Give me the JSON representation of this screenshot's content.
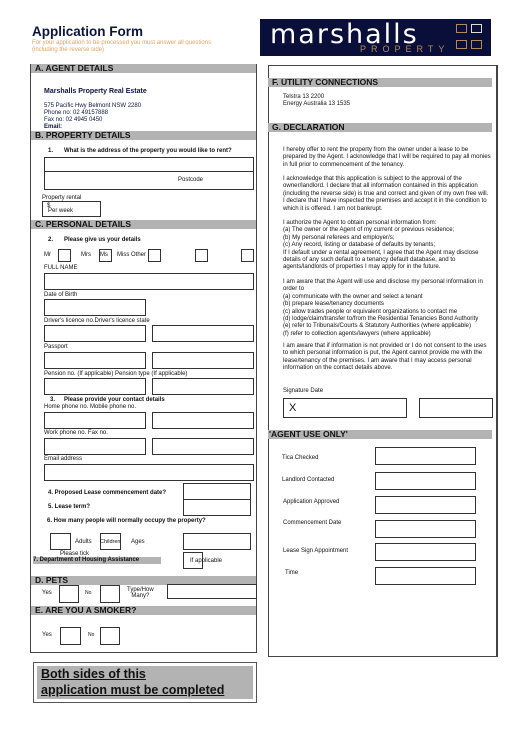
{
  "header": {
    "title": "Application Form",
    "subtitle": "For your application to be processed you must answer all questions (including the reverse side)",
    "logo_text": "marshalls",
    "logo_sub": "PROPERTY",
    "brand_color": "#0a0f3a",
    "accent_color": "#e3a360"
  },
  "agent": {
    "heading": "A. AGENT DETAILS",
    "name": "Marshalls Property Real Estate",
    "address": "575 Pacific Hwy Belmont NSW 2280",
    "phone": "Phone no: 02 49157888",
    "fax": "Fax no: 02 4945 0450",
    "email": "Email:"
  },
  "property": {
    "heading": "B. PROPERTY DETAILS",
    "q1_num": "1.",
    "q1": "What is the address of the property you would like to rent?",
    "postcode": "Postcode",
    "rental_label": "Property rental",
    "dollar": "$",
    "per_week": "Per week"
  },
  "personal": {
    "heading": "C. PERSONAL DETAILS",
    "q2_num": "2.",
    "q2": "Please give us your details",
    "mr": "Mr",
    "mrs": "Mrs",
    "ms": "Ms",
    "miss_other": "Miss Other",
    "full_name": "FULL NAME",
    "dob": "Date of Birth",
    "licence": "Driver's licence no.Driver's licence state",
    "passport": "Passport",
    "pension": "Pension no. (If applicable) Pension type (If applicable)",
    "q3_num": "3.",
    "q3": "Please provide your contact details",
    "home_mobile": "Home phone no. Mobile phone no.",
    "work_fax": "Work phone no. Fax no.",
    "email": "Email address",
    "q4": "4. Proposed Lease commencement date?",
    "q5": "5. Lease term?",
    "q6": "6. How many people will normally occupy the property?",
    "adults": "Adults",
    "children": "Children",
    "ages": "Ages",
    "please_tick": "Please tick",
    "q7": "7. Department of Housing Assistance",
    "if_applicable": "If applicable"
  },
  "pets": {
    "heading": "D.  PETS",
    "yes": "Yes",
    "no": "No",
    "type": "Type/How\nMany?"
  },
  "smoker": {
    "heading": "E.  ARE YOU A SMOKER?",
    "yes": "Yes",
    "no": "No"
  },
  "footer": {
    "line1": "Both sides of this",
    "line2": "application must be completed"
  },
  "utility": {
    "heading": "F. UTILITY CONNECTIONS",
    "telstra": "Telstra   13 2200",
    "energy": "Energy Australia  13 1535"
  },
  "declaration": {
    "heading": "G.  DECLARATION",
    "p1": "I hereby offer to rent the property from the owner under a lease to be\nprepared by the Agent. I acknowledge that I will be required to pay all monies\nin full prior to commencement of the tenancy.",
    "p2": "I acknowledge that this application is subject to the approval of the\nowner/landlord. I declare that all information contained in this application\n(including the reverse side) is true and correct and given of my own free will.\nI declare that I have inspected the premises and accept it in the condition to\nwhich it is offered. I am not bankrupt.",
    "p3": "I authorize the Agent to obtain personal information from:\n(a) The owner or the Agent of my current or previous residence;\n(b)       My personal referees and employer/s;\n(c) Any record, listing or database of defaults by tenants;\nIf I default under a rental agreement, I agree that the Agent may disclose\ndetails of any such default to a tenancy default database, and to\nagents/landlords of properties I may apply for in the future.",
    "p4": "I am aware that the Agent will use and disclose my personal information in\norder to\n(a) communicate with the owner and select a tenant\n(b) prepare lease/tenancy documents\n(c) allow trades people or equivalent organizations to contact me\n(d) lodge/claim/transfer to/from the Residential Tenancies Bond Authority\n(e) refer  to Tribunals/Courts & Statutory Authorities (where applicable)\n(f) refer  to collection agents/lawyers (where applicable)",
    "p5": "I am aware that if information is not provided or I do not consent to the uses\nto which personal information is put, the Agent cannot provide me with the\nlease/tenancy of the premises.  I am aware that I may access personal\ninformation on the contact details above.",
    "sig_date": "Signature Date",
    "sig_x": "X"
  },
  "agent_use": {
    "heading": "'AGENT USE ONLY'",
    "tica": "Tica Checked",
    "landlord": "Landlord Contacted",
    "approved": "Application Approved",
    "commencement": "Commencement Date",
    "lease_sign": "Lease Sign Appointment",
    "time": "Time"
  }
}
